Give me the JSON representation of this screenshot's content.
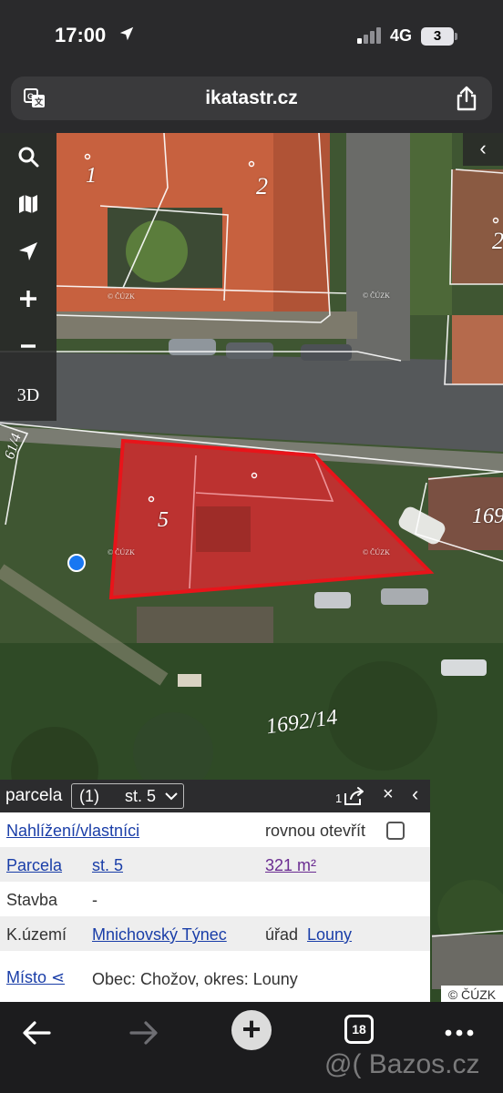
{
  "status_bar": {
    "time": "17:00",
    "network": "4G",
    "battery_badge": "3"
  },
  "browser": {
    "url": "ikatastr.cz"
  },
  "map": {
    "tools": {
      "three_d_label": "3D"
    },
    "collapse_glyph": "‹",
    "parcel_labels": {
      "label_1": "1",
      "label_2": "2",
      "label_2_right": "2",
      "label_5": "5",
      "label_61_4": "61/4",
      "label_169": "169",
      "label_1692_14": "1692/14"
    },
    "cuzk_marks": [
      "© ČÚZK",
      "© ČÚZK",
      "© ČÚZK",
      "© ČÚZK"
    ],
    "highlight_color": "#e8141a",
    "copyright": "© ČÚZK"
  },
  "panel": {
    "header_label": "parcela",
    "select_count": "(1)",
    "select_value": "st. 5",
    "share_count": "1",
    "close_glyph": "×",
    "back_glyph": "‹",
    "rows": {
      "owners_link": "Nahlížení/vlastníci",
      "open_directly": "rovnou otevřít",
      "parcel_label": "Parcela",
      "parcel_value": "st. 5",
      "area": "321 m²",
      "building_label": "Stavba",
      "building_value": "-",
      "cadastral_label": "K.území",
      "cadastral_value": "Mnichovský Týnec",
      "office_label": "úřad",
      "office_value": "Louny",
      "place_link": "Místo ⋖",
      "place_value": "Obec: Chožov, okres: Louny"
    }
  },
  "toolbar": {
    "tabs_count": "18"
  },
  "watermark": "@( Bazos.cz"
}
